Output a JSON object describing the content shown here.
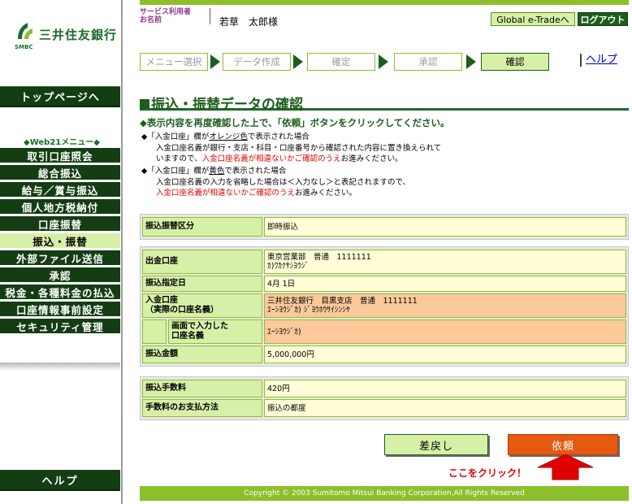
{
  "sidebar": {
    "bank_name": "三井住友銀行",
    "bank_short": "SMBC",
    "top_page": "トップページへ",
    "menu_heading": "◆Web21メニュー◆",
    "items": [
      {
        "label": "取引口座照会"
      },
      {
        "label": "総合振込"
      },
      {
        "label": "給与／賞与振込"
      },
      {
        "label": "個人地方税納付"
      },
      {
        "label": "口座振替"
      },
      {
        "label": "振込・振替"
      },
      {
        "label": "外部ファイル送信"
      },
      {
        "label": "承認"
      },
      {
        "label": "税金・各種料金の払込"
      },
      {
        "label": "口座情報事前設定"
      },
      {
        "label": "セキュリティ管理"
      }
    ],
    "help": "ヘルプ"
  },
  "header": {
    "user_label_1": "サービス利用者",
    "user_label_2": "お名前",
    "user_name": "若草　太郎様",
    "global_btn": "Global e-Tradeへ",
    "logout_btn": "ログアウト"
  },
  "steps": {
    "items": [
      "メニュー選択",
      "データ作成",
      "確定",
      "承認",
      "確認"
    ],
    "current_index": 4,
    "help_link": "ヘルプ"
  },
  "page": {
    "title": "振込・振替データの確認",
    "instruction": "◆表示内容を再度確認した上で、「依頼」ボタンをクリックしてください。",
    "note1_pre": "◆「入金口座」欄が",
    "note1_color": "オレンジ色",
    "note1_post": "で表示された場合",
    "note1_body1": "入金口座名義が銀行・支店・科目・口座番号から確認された内容に置き換えられて",
    "note1_body2_pre": "いますので、",
    "note1_body2_red": "入金口座名義が相違ないかご確認のうえ",
    "note1_body2_post": "お進みください。",
    "note2_pre": "◆「入金口座」欄が",
    "note2_color": "黄色",
    "note2_post": "で表示された場合",
    "note2_body1": "入金口座名義の入力を省略した場合は＜入力なし＞と表記されますので、",
    "note2_body2_red": "入金口座名義が相違ないかご確認のうえ",
    "note2_body2_post": "お進みください。"
  },
  "details": {
    "type_label": "振込振替区分",
    "type_value": "即時振込",
    "debit_label": "出金口座",
    "debit_value1": "東京営業部　普通　1111111",
    "debit_value2": "ｶ)ﾜｶｸｻｼﾖｳｼﾞ",
    "date_label": "振込指定日",
    "date_value": "4月 1日",
    "credit_label1": "入金口座",
    "credit_label2": "（実際の口座名義）",
    "credit_value1": "三井住友銀行　目黒支店　普通　1111111",
    "credit_value2": "ｴｰｼﾖｳｼﾞｶ) ｼﾞﾖｳﾎｳｻｲｼﾝｼﾔ",
    "input_name_label1": "画面で入力した",
    "input_name_label2": "口座名義",
    "input_name_value": "ｴｰｼﾖｳｼﾞｶ)",
    "amount_label": "振込金額",
    "amount_value": "5,000,000円",
    "fee_label": "振込手数料",
    "fee_value": "420円",
    "fee_method_label": "手数料のお支払方法",
    "fee_method_value": "振込の都度"
  },
  "actions": {
    "back": "差戻し",
    "submit": "依頼",
    "click_here": "ここをクリック！"
  },
  "footer": "Copyright © 2003 Sumitomo Mitsui Banking Corporation,All Rights Reserved",
  "colors": {
    "brand_dark": "#143d14",
    "brand_green": "#1b6b2a",
    "light_green": "#d7f0a8",
    "accent_green": "#8dbf2a",
    "orange_highlight": "#fbc99a",
    "submit": "#e45a12",
    "alert_red": "#e00000"
  }
}
